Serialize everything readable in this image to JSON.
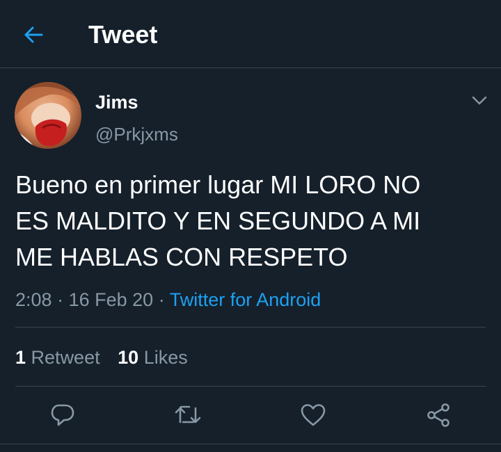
{
  "header": {
    "title": "Tweet",
    "back_icon": "arrow-left-icon"
  },
  "colors": {
    "background": "#15202b",
    "accent": "#1da1f2",
    "secondary_text": "#8899a6",
    "divider": "#38444d"
  },
  "tweet": {
    "author": {
      "display_name": "Jims",
      "handle": "@Prkjxms"
    },
    "text_lines": [
      "Bueno en primer lugar MI LORO NO",
      "ES MALDITO Y EN SEGUNDO A MI",
      "ME HABLAS CON RESPETO"
    ],
    "time": "2:08",
    "separator": "·",
    "date": "16 Feb 20",
    "source": "Twitter for Android"
  },
  "stats": {
    "retweets_count": "1",
    "retweets_label": "Retweet",
    "likes_count": "10",
    "likes_label": "Likes"
  },
  "actions": {
    "reply_icon": "reply-icon",
    "retweet_icon": "retweet-icon",
    "like_icon": "heart-icon",
    "share_icon": "share-icon"
  }
}
